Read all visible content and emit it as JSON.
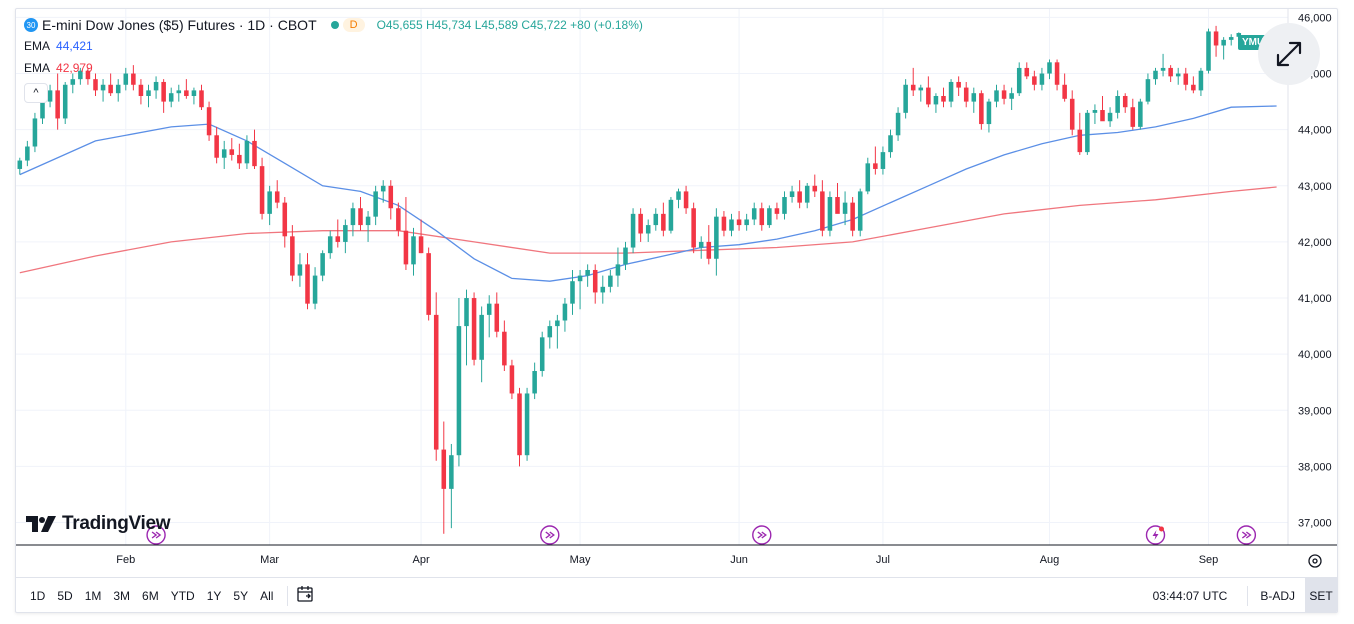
{
  "header": {
    "symbol_badge": "30",
    "title": "E-mini Dow Jones ($5) Futures · 1D · CBOT",
    "d_badge": "D",
    "ohlc_open_label": "O",
    "ohlc_open": "45,655",
    "ohlc_high_label": "H",
    "ohlc_high": "45,734",
    "ohlc_low_label": "L",
    "ohlc_low": "45,589",
    "ohlc_close_label": "C",
    "ohlc_close": "45,722",
    "ohlc_change": "+80 (+0.18%)"
  },
  "indicators": [
    {
      "label": "EMA",
      "value": "44,421",
      "color": "#2962ff"
    },
    {
      "label": "EMA",
      "value": "42,979",
      "color": "#f23645"
    }
  ],
  "collapse_icon": "^",
  "logo_text": "TradingView",
  "price_tag": "YMU",
  "price_axis_top": "46,000",
  "bottom_bar": {
    "ranges": [
      "1D",
      "5D",
      "1M",
      "3M",
      "6M",
      "YTD",
      "1Y",
      "5Y",
      "All"
    ],
    "time": "03:44:07 UTC",
    "badj": "B-ADJ",
    "set": "SET"
  },
  "colors": {
    "up": "#26a69a",
    "down": "#f23645",
    "ema_fast": "#5b8fe6",
    "ema_slow": "#f0767e",
    "grid": "#f0f3fa"
  },
  "chart_data": {
    "type": "candlestick",
    "y_ticks": [
      37000,
      38000,
      39000,
      40000,
      41000,
      42000,
      43000,
      44000,
      45000,
      46000
    ],
    "y_tick_labels": [
      "37,000",
      "38,000",
      "39,000",
      "40,000",
      "41,000",
      "42,000",
      "43,000",
      "44,000",
      "45,000",
      "46,000"
    ],
    "ylim": [
      36600,
      46150
    ],
    "x_month_labels": [
      "Feb",
      "Mar",
      "Apr",
      "May",
      "Jun",
      "Jul",
      "Aug",
      "Sep"
    ],
    "x_month_index": [
      14,
      33,
      53,
      74,
      95,
      114,
      136,
      157
    ],
    "x_range": [
      0,
      168
    ],
    "candles": [
      [
        43300,
        43500,
        43200,
        43450
      ],
      [
        43450,
        43800,
        43350,
        43700
      ],
      [
        43700,
        44300,
        43600,
        44200
      ],
      [
        44200,
        44600,
        44100,
        44500
      ],
      [
        44500,
        44800,
        44400,
        44700
      ],
      [
        44700,
        45000,
        44000,
        44200
      ],
      [
        44200,
        44850,
        44100,
        44800
      ],
      [
        44800,
        45000,
        44650,
        44900
      ],
      [
        44900,
        45100,
        44800,
        45050
      ],
      [
        45050,
        45100,
        44800,
        44900
      ],
      [
        44900,
        45000,
        44600,
        44700
      ],
      [
        44700,
        44900,
        44500,
        44800
      ],
      [
        44800,
        45000,
        44600,
        44650
      ],
      [
        44650,
        44900,
        44500,
        44800
      ],
      [
        44800,
        45100,
        44700,
        45000
      ],
      [
        45000,
        45150,
        44700,
        44800
      ],
      [
        44800,
        44900,
        44450,
        44600
      ],
      [
        44600,
        44800,
        44400,
        44700
      ],
      [
        44700,
        44950,
        44550,
        44850
      ],
      [
        44850,
        44900,
        44300,
        44500
      ],
      [
        44500,
        44750,
        44400,
        44650
      ],
      [
        44650,
        44800,
        44500,
        44700
      ],
      [
        44700,
        44900,
        44550,
        44600
      ],
      [
        44600,
        44750,
        44450,
        44700
      ],
      [
        44700,
        44800,
        44350,
        44400
      ],
      [
        44400,
        44500,
        43800,
        43900
      ],
      [
        43900,
        44050,
        43400,
        43500
      ],
      [
        43500,
        43800,
        43300,
        43650
      ],
      [
        43650,
        43850,
        43450,
        43550
      ],
      [
        43550,
        43750,
        43300,
        43400
      ],
      [
        43400,
        43900,
        43300,
        43800
      ],
      [
        43800,
        44000,
        43300,
        43350
      ],
      [
        43350,
        43500,
        42400,
        42500
      ],
      [
        42500,
        43000,
        42300,
        42900
      ],
      [
        42900,
        43100,
        42600,
        42700
      ],
      [
        42700,
        42800,
        41900,
        42100
      ],
      [
        42100,
        42300,
        41300,
        41400
      ],
      [
        41400,
        41800,
        41200,
        41600
      ],
      [
        41600,
        41800,
        40800,
        40900
      ],
      [
        40900,
        41550,
        40800,
        41400
      ],
      [
        41400,
        41850,
        41300,
        41800
      ],
      [
        41800,
        42200,
        41700,
        42100
      ],
      [
        42100,
        42400,
        41900,
        42000
      ],
      [
        42000,
        42400,
        41800,
        42300
      ],
      [
        42300,
        42700,
        42100,
        42600
      ],
      [
        42600,
        42800,
        42200,
        42300
      ],
      [
        42300,
        42550,
        42000,
        42450
      ],
      [
        42450,
        43000,
        42300,
        42900
      ],
      [
        42900,
        43100,
        42700,
        43000
      ],
      [
        43000,
        43100,
        42400,
        42600
      ],
      [
        42600,
        42700,
        42100,
        42200
      ],
      [
        42200,
        42800,
        41500,
        41600
      ],
      [
        41600,
        42250,
        41400,
        42100
      ],
      [
        42100,
        42400,
        41800,
        41800
      ],
      [
        41800,
        41900,
        40600,
        40700
      ],
      [
        40700,
        41100,
        38100,
        38300
      ],
      [
        38300,
        38800,
        36800,
        37600
      ],
      [
        37600,
        38400,
        36900,
        38200
      ],
      [
        38200,
        41000,
        38000,
        40500
      ],
      [
        40500,
        41150,
        39800,
        41000
      ],
      [
        41000,
        41100,
        39800,
        39900
      ],
      [
        39900,
        40850,
        39500,
        40700
      ],
      [
        40700,
        41050,
        40300,
        40900
      ],
      [
        40900,
        41100,
        40300,
        40400
      ],
      [
        40400,
        40600,
        39700,
        39800
      ],
      [
        39800,
        39900,
        39200,
        39300
      ],
      [
        39300,
        39400,
        38000,
        38200
      ],
      [
        38200,
        39400,
        38100,
        39300
      ],
      [
        39300,
        39850,
        39200,
        39700
      ],
      [
        39700,
        40400,
        39600,
        40300
      ],
      [
        40300,
        40600,
        40100,
        40500
      ],
      [
        40500,
        40700,
        40100,
        40600
      ],
      [
        40600,
        41000,
        40400,
        40900
      ],
      [
        40900,
        41500,
        40700,
        41300
      ],
      [
        41300,
        41500,
        40800,
        41400
      ],
      [
        41400,
        41600,
        41200,
        41500
      ],
      [
        41500,
        41600,
        40900,
        41100
      ],
      [
        41100,
        41400,
        40900,
        41200
      ],
      [
        41200,
        41500,
        41100,
        41400
      ],
      [
        41400,
        41900,
        41200,
        41600
      ],
      [
        41600,
        42000,
        41500,
        41900
      ],
      [
        41900,
        42600,
        41800,
        42500
      ],
      [
        42500,
        42600,
        42000,
        42150
      ],
      [
        42150,
        42400,
        42000,
        42300
      ],
      [
        42300,
        42600,
        42200,
        42500
      ],
      [
        42500,
        42700,
        42100,
        42200
      ],
      [
        42200,
        42800,
        42150,
        42750
      ],
      [
        42750,
        42950,
        42600,
        42900
      ],
      [
        42900,
        43000,
        42500,
        42600
      ],
      [
        42600,
        42700,
        41800,
        41900
      ],
      [
        41900,
        42100,
        41700,
        42000
      ],
      [
        42000,
        42300,
        41600,
        41700
      ],
      [
        41700,
        42600,
        41400,
        42450
      ],
      [
        42450,
        42550,
        42100,
        42200
      ],
      [
        42200,
        42500,
        42100,
        42400
      ],
      [
        42400,
        42550,
        42200,
        42300
      ],
      [
        42300,
        42500,
        42200,
        42400
      ],
      [
        42400,
        42700,
        42300,
        42600
      ],
      [
        42600,
        42700,
        42200,
        42300
      ],
      [
        42300,
        42650,
        42250,
        42600
      ],
      [
        42600,
        42700,
        42400,
        42500
      ],
      [
        42500,
        42900,
        42400,
        42800
      ],
      [
        42800,
        43000,
        42700,
        42900
      ],
      [
        42900,
        43100,
        42600,
        42700
      ],
      [
        42700,
        43050,
        42600,
        43000
      ],
      [
        43000,
        43200,
        42800,
        42900
      ],
      [
        42900,
        43100,
        42100,
        42200
      ],
      [
        42200,
        42900,
        42100,
        42800
      ],
      [
        42800,
        43050,
        42600,
        42500
      ],
      [
        42500,
        42900,
        42300,
        42700
      ],
      [
        42700,
        42800,
        42100,
        42200
      ],
      [
        42200,
        42950,
        42100,
        42900
      ],
      [
        42900,
        43500,
        42850,
        43400
      ],
      [
        43400,
        43700,
        43200,
        43300
      ],
      [
        43300,
        43700,
        43200,
        43600
      ],
      [
        43600,
        44000,
        43500,
        43900
      ],
      [
        43900,
        44400,
        43800,
        44300
      ],
      [
        44300,
        44900,
        44200,
        44800
      ],
      [
        44800,
        45100,
        44600,
        44700
      ],
      [
        44700,
        44800,
        44500,
        44750
      ],
      [
        44750,
        44950,
        44400,
        44450
      ],
      [
        44450,
        44650,
        44300,
        44600
      ],
      [
        44600,
        44750,
        44400,
        44500
      ],
      [
        44500,
        44900,
        44400,
        44850
      ],
      [
        44850,
        44950,
        44600,
        44750
      ],
      [
        44750,
        44850,
        44400,
        44500
      ],
      [
        44500,
        44750,
        44300,
        44650
      ],
      [
        44650,
        44700,
        44000,
        44100
      ],
      [
        44100,
        44550,
        43950,
        44500
      ],
      [
        44500,
        44800,
        44400,
        44700
      ],
      [
        44700,
        44800,
        44450,
        44550
      ],
      [
        44550,
        44750,
        44350,
        44650
      ],
      [
        44650,
        45200,
        44600,
        45100
      ],
      [
        45100,
        45200,
        44900,
        44950
      ],
      [
        44950,
        45050,
        44700,
        44800
      ],
      [
        44800,
        45100,
        44700,
        45000
      ],
      [
        45000,
        45250,
        44900,
        45200
      ],
      [
        45200,
        45250,
        44700,
        44800
      ],
      [
        44800,
        45000,
        44500,
        44550
      ],
      [
        44550,
        44700,
        43900,
        44000
      ],
      [
        44000,
        44300,
        43550,
        43600
      ],
      [
        43600,
        44350,
        43550,
        44300
      ],
      [
        44300,
        44450,
        44100,
        44350
      ],
      [
        44350,
        44600,
        44200,
        44150
      ],
      [
        44150,
        44400,
        44050,
        44300
      ],
      [
        44300,
        44700,
        44200,
        44600
      ],
      [
        44600,
        44650,
        44300,
        44400
      ],
      [
        44400,
        44550,
        44000,
        44050
      ],
      [
        44050,
        44550,
        44000,
        44500
      ],
      [
        44500,
        45000,
        44450,
        44900
      ],
      [
        44900,
        45100,
        44800,
        45050
      ],
      [
        45050,
        45350,
        44950,
        45100
      ],
      [
        45100,
        45150,
        44850,
        44950
      ],
      [
        44950,
        45100,
        44800,
        45000
      ],
      [
        45000,
        45100,
        44700,
        44800
      ],
      [
        44800,
        44950,
        44650,
        44700
      ],
      [
        44700,
        45100,
        44600,
        45050
      ],
      [
        45050,
        45800,
        45000,
        45750
      ],
      [
        45750,
        45850,
        45300,
        45500
      ],
      [
        45500,
        45650,
        45250,
        45600
      ],
      [
        45600,
        45700,
        45500,
        45650
      ],
      [
        45655,
        45734,
        45589,
        45722
      ]
    ],
    "ema_fast": [
      [
        0,
        43200
      ],
      [
        10,
        43800
      ],
      [
        20,
        44050
      ],
      [
        25,
        44100
      ],
      [
        30,
        43800
      ],
      [
        35,
        43400
      ],
      [
        40,
        43000
      ],
      [
        45,
        42900
      ],
      [
        50,
        42650
      ],
      [
        55,
        42200
      ],
      [
        60,
        41700
      ],
      [
        65,
        41350
      ],
      [
        70,
        41300
      ],
      [
        75,
        41400
      ],
      [
        80,
        41600
      ],
      [
        85,
        41750
      ],
      [
        90,
        41900
      ],
      [
        95,
        41950
      ],
      [
        100,
        42050
      ],
      [
        105,
        42200
      ],
      [
        110,
        42400
      ],
      [
        115,
        42700
      ],
      [
        120,
        43000
      ],
      [
        125,
        43300
      ],
      [
        130,
        43550
      ],
      [
        135,
        43750
      ],
      [
        140,
        43900
      ],
      [
        145,
        43950
      ],
      [
        150,
        44050
      ],
      [
        155,
        44200
      ],
      [
        160,
        44400
      ],
      [
        166,
        44421
      ]
    ],
    "ema_slow": [
      [
        0,
        41450
      ],
      [
        10,
        41750
      ],
      [
        20,
        42000
      ],
      [
        30,
        42150
      ],
      [
        40,
        42200
      ],
      [
        50,
        42200
      ],
      [
        60,
        42000
      ],
      [
        70,
        41800
      ],
      [
        80,
        41800
      ],
      [
        90,
        41850
      ],
      [
        100,
        41900
      ],
      [
        110,
        42000
      ],
      [
        120,
        42250
      ],
      [
        130,
        42500
      ],
      [
        140,
        42650
      ],
      [
        150,
        42750
      ],
      [
        160,
        42900
      ],
      [
        166,
        42979
      ]
    ],
    "event_markers": [
      [
        18,
        "forward"
      ],
      [
        70,
        "forward"
      ],
      [
        98,
        "forward"
      ],
      [
        150,
        "lightning"
      ],
      [
        162,
        "forward"
      ]
    ]
  }
}
